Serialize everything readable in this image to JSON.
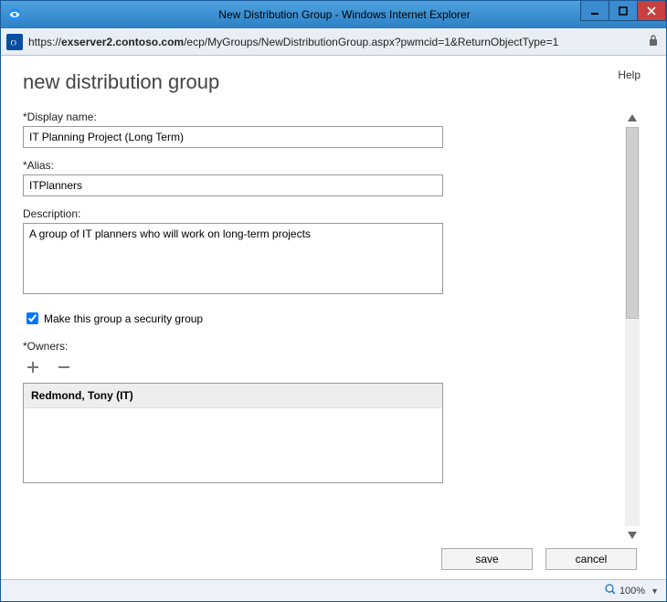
{
  "window": {
    "title": "New Distribution Group - Windows Internet Explorer"
  },
  "address": {
    "scheme": "https://",
    "host": "exserver2.contoso.com",
    "path": "/ecp/MyGroups/NewDistributionGroup.aspx?pwmcid=1&ReturnObjectType=1",
    "favicon_label": "outlook-icon"
  },
  "page": {
    "heading": "new distribution group",
    "help_label": "Help"
  },
  "form": {
    "display_name": {
      "label": "*Display name:",
      "value": "IT Planning Project (Long Term)"
    },
    "alias": {
      "label": "*Alias:",
      "value": "ITPlanners"
    },
    "description": {
      "label": "Description:",
      "value": "A group of IT planners who will work on long-term projects"
    },
    "security_group": {
      "label": "Make this group a security group",
      "checked": true
    },
    "owners": {
      "label": "*Owners:",
      "items": [
        "Redmond, Tony (IT)"
      ]
    }
  },
  "buttons": {
    "save": "save",
    "cancel": "cancel"
  },
  "status": {
    "zoom": "100%"
  }
}
